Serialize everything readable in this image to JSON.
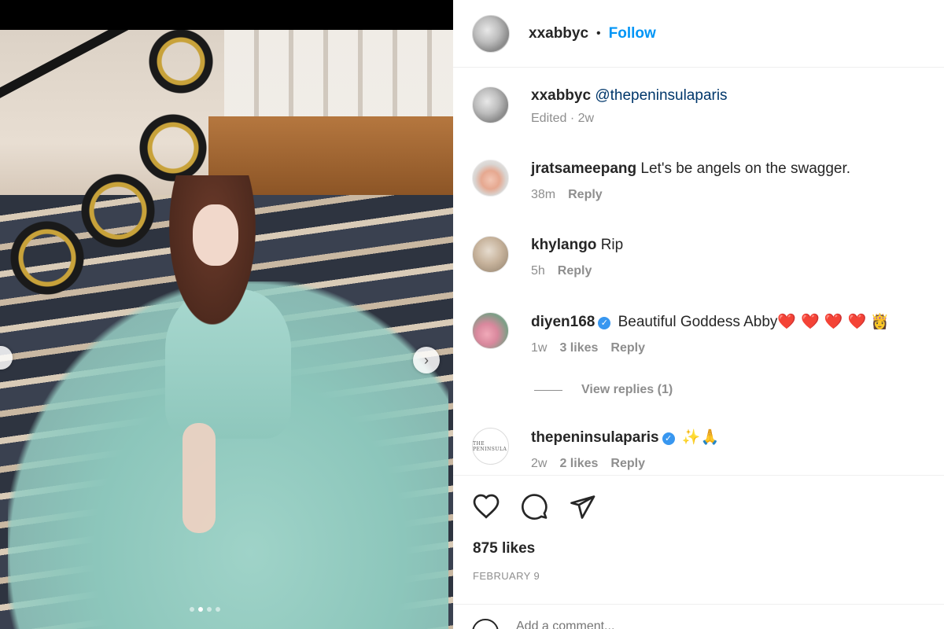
{
  "post": {
    "carousel": {
      "dot_count": 4,
      "active_index": 1
    }
  },
  "header": {
    "username": "xxabbyc",
    "separator": "•",
    "follow_label": "Follow"
  },
  "caption": {
    "username": "xxabbyc",
    "text": "@thepeninsulaparis",
    "edited": "Edited · 2w"
  },
  "comments": [
    {
      "username": "jratsameepang",
      "text": "Let's be angels on the swagger.",
      "time": "38m",
      "reply": "Reply",
      "verified": false
    },
    {
      "username": "khylango",
      "text": "Rip",
      "time": "5h",
      "reply": "Reply",
      "verified": false
    },
    {
      "username": "diyen168",
      "text": "Beautiful Goddess Abby",
      "hearts": "❤️ ❤️ ❤️ ❤️",
      "emoji_extra": "👸",
      "time": "1w",
      "likes": "3 likes",
      "reply": "Reply",
      "verified": true
    },
    {
      "username": "thepeninsulaparis",
      "emoji": "✨🙏",
      "time": "2w",
      "likes": "2 likes",
      "reply": "Reply",
      "verified": true
    }
  ],
  "view_replies": "View replies (1)",
  "peninsula_avatar_text": "THE PENINSULA",
  "actions": {
    "icons": [
      "heart-icon",
      "comment-icon",
      "share-icon"
    ]
  },
  "likes_count": "875 likes",
  "post_date": "FEBRUARY 9",
  "add_comment": {
    "placeholder": "Add a comment..."
  },
  "colors": {
    "link_blue": "#0095f6",
    "mention": "#00376b",
    "meta_gray": "#8e8e8e",
    "verified_blue": "#3897f0"
  }
}
